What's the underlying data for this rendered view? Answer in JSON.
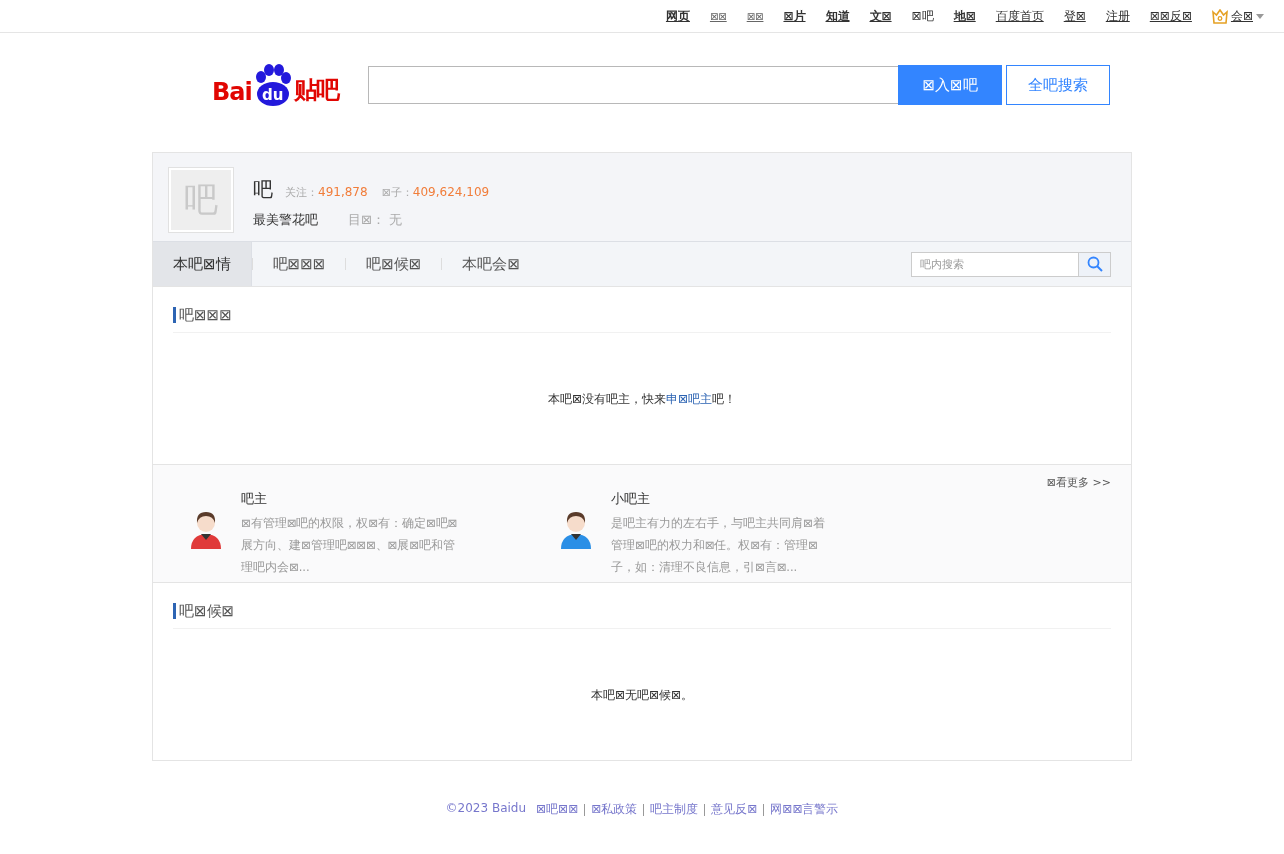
{
  "top_nav": [
    {
      "label": "网页",
      "kind": "bold"
    },
    {
      "label": "⊠⊠",
      "kind": "small"
    },
    {
      "label": "⊠⊠",
      "kind": "small"
    },
    {
      "label": "⊠片",
      "kind": "bold"
    },
    {
      "label": "知道",
      "kind": "bold"
    },
    {
      "label": "文⊠",
      "kind": "bold"
    },
    {
      "label": "⊠吧",
      "kind": "current"
    },
    {
      "label": "地⊠",
      "kind": "bold"
    },
    {
      "label": "百度首页",
      "kind": "link"
    },
    {
      "label": "登⊠",
      "kind": "link"
    },
    {
      "label": "注册",
      "kind": "link"
    },
    {
      "label": "⊠⊠反⊠",
      "kind": "link"
    },
    {
      "label": "会⊠",
      "kind": "member"
    }
  ],
  "logo": {
    "left": "Bai",
    "paw": "du",
    "right": "贴吧"
  },
  "search": {
    "enter_button": "⊠入⊠吧",
    "all_button": "全吧搜索"
  },
  "forum": {
    "avatar_char": "吧",
    "name": "吧",
    "follow_label": "关注：",
    "follow_count": "491,878",
    "posts_label": "⊠子：",
    "posts_count": "409,624,109",
    "slogan": "最美警花吧",
    "dir_label": "目⊠：",
    "dir_value": "无"
  },
  "tabs": [
    {
      "label": "本吧⊠情",
      "selected": true
    },
    {
      "label": "吧⊠⊠⊠",
      "selected": false
    },
    {
      "label": "吧⊠候⊠",
      "selected": false
    },
    {
      "label": "本吧会⊠",
      "selected": false
    }
  ],
  "inner_search": {
    "placeholder": "吧内搜索"
  },
  "managers": {
    "title": "吧⊠⊠⊠",
    "empty_before": "本吧⊠没有吧主，快来",
    "apply_link": "申⊠吧主",
    "empty_after": "吧！",
    "more": "⊠看更多 >>",
    "roles": [
      {
        "name": "吧主",
        "color": "#e03a3a",
        "description": "⊠有管理⊠吧的权限，权⊠有：确定⊠吧⊠展方向、建⊠管理吧⊠⊠⊠、⊠展⊠吧和管理吧内会⊠..."
      },
      {
        "name": "小吧主",
        "color": "#2b8fe6",
        "description": "是吧主有力的左右手，与吧主共同肩⊠着管理⊠吧的权力和⊠任。权⊠有：管理⊠子，如：清理不良信息，引⊠言⊠..."
      }
    ]
  },
  "candidates": {
    "title": "吧⊠候⊠",
    "empty": "本吧⊠无吧⊠候⊠。"
  },
  "footer": {
    "copyright": "©2023 Baidu",
    "links": [
      "⊠吧⊠⊠",
      "⊠私政策",
      "吧主制度",
      "意见反⊠",
      "网⊠⊠言警示"
    ]
  }
}
